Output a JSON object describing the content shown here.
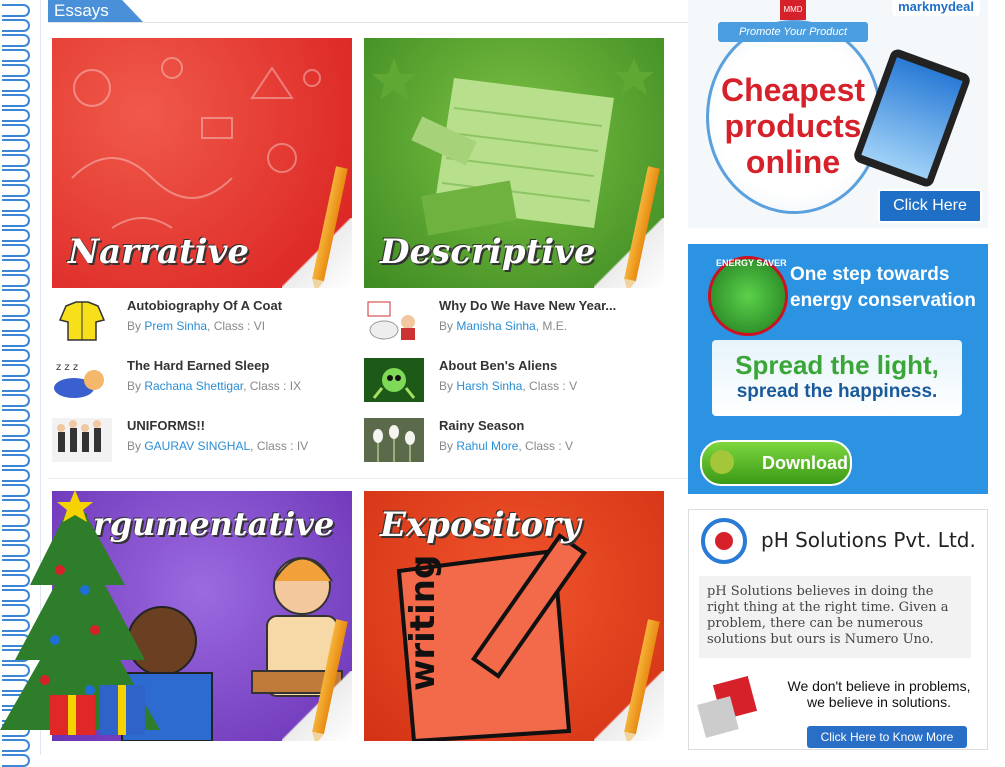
{
  "section_tab": "Essays",
  "cards": [
    {
      "title": "Narrative"
    },
    {
      "title": "Descriptive"
    },
    {
      "title": "Argumentative"
    },
    {
      "title": "Expository"
    }
  ],
  "narrative_items": [
    {
      "title": "Autobiography Of A Coat",
      "by": "By ",
      "author": "Prem Sinha",
      "class": ", Class : VI"
    },
    {
      "title": "The Hard Earned Sleep",
      "by": "By ",
      "author": "Rachana Shettigar",
      "class": ", Class : IX"
    },
    {
      "title": "UNIFORMS!!",
      "by": "By ",
      "author": "GAURAV SINGHAL",
      "class": ", Class : IV"
    }
  ],
  "descriptive_items": [
    {
      "title": "Why Do We Have New Year...",
      "by": "By ",
      "author": "Manisha Sinha",
      "class": ", M.E."
    },
    {
      "title": "About Ben's Aliens",
      "by": "By ",
      "author": "Harsh Sinha",
      "class": ", Class : V"
    },
    {
      "title": "Rainy Season",
      "by": "By ",
      "author": "Rahul More",
      "class": ", Class : V"
    }
  ],
  "ads": {
    "markmydeal": {
      "brand": "markmydeal",
      "badge": "MMD",
      "ribbon": "Promote Your Product",
      "headline_1": "Cheapest",
      "headline_2": "products",
      "headline_3": "online",
      "button": "Click Here"
    },
    "energy": {
      "badge": "ENERGY SAVER",
      "headline": "One step towards energy conservation",
      "tag_1": "Spread the light,",
      "tag_2": "spread the happiness.",
      "button": "Download"
    },
    "ph": {
      "company": "pH Solutions Pvt. Ltd.",
      "body": "pH Solutions believes in doing the right thing at the right time. Given a problem, there can be numerous solutions but ours is Numero Uno.",
      "slogan_1": "We don't believe in problems,",
      "slogan_2": "we believe in solutions.",
      "button": "Click Here to Know More"
    }
  },
  "colors": {
    "narrative": "#e8302c",
    "descriptive": "#4f9a2d",
    "argumentative": "#7f47c4",
    "expository": "#e2401f",
    "link": "#2a8ed4",
    "tab": "#4a90d9"
  }
}
